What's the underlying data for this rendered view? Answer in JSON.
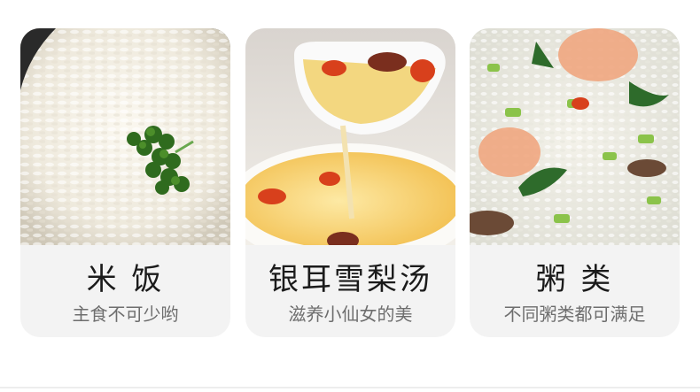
{
  "cards": [
    {
      "title": "米 饭",
      "subtitle": "主食不可少哟",
      "photo_icon": "rice-photo"
    },
    {
      "title": "银耳雪梨汤",
      "subtitle": "滋养小仙女的美",
      "photo_icon": "soup-photo"
    },
    {
      "title": "粥 类",
      "subtitle": "不同粥类都可满足",
      "photo_icon": "congee-photo"
    }
  ],
  "colors": {
    "card_bg": "#f3f3f3",
    "title": "#1b1b1b",
    "subtitle": "#6e6e6e"
  }
}
